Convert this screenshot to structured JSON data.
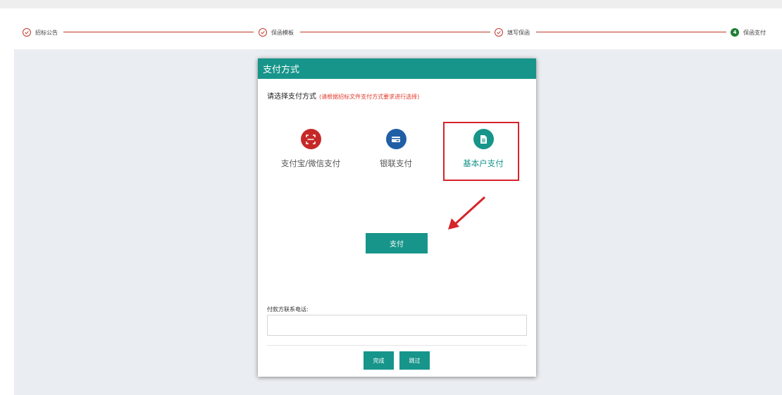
{
  "steps": [
    {
      "label": "招标公告",
      "state": "done"
    },
    {
      "label": "保函模板",
      "state": "done"
    },
    {
      "label": "填写保函",
      "state": "done"
    },
    {
      "label": "保函支付",
      "state": "current",
      "number": "4"
    }
  ],
  "dialog": {
    "title": "支付方式",
    "prompt": "请选择支付方式",
    "hint": "(请根据招标文件支付方式要求进行选择)",
    "options": [
      {
        "label": "支付宝/微信支付",
        "icon": "scan-icon",
        "color": "#c62828"
      },
      {
        "label": "银联支付",
        "icon": "card-icon",
        "color": "#1f5fa6"
      },
      {
        "label": "基本户支付",
        "icon": "document-icon",
        "color": "#17958a",
        "selected": true
      }
    ],
    "pay_button": "支付",
    "phone_label": "付款方联系电话:",
    "phone_value": "",
    "done_button": "完成",
    "skip_button": "跳过"
  },
  "colors": {
    "accent": "#17958a",
    "step_line": "#c0392b",
    "highlight": "#d6242b"
  }
}
